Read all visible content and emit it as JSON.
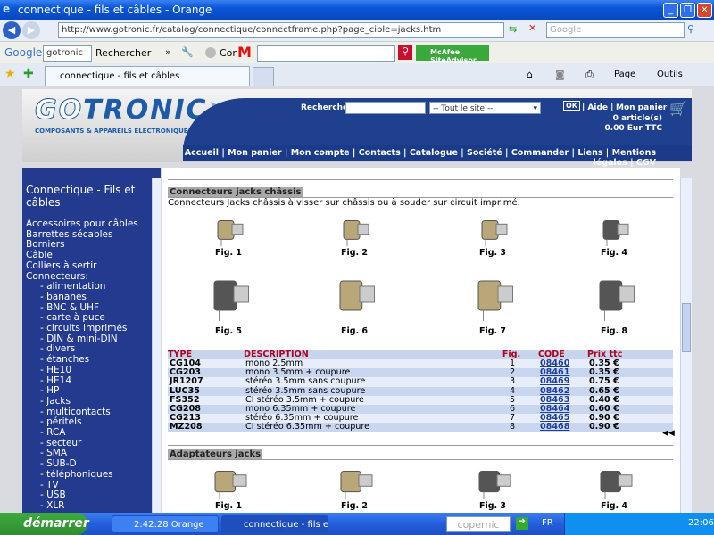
{
  "window": {
    "title": "connectique - fils et câbles - Orange"
  },
  "address": {
    "url": "http://www.gotronic.fr/catalog/connectique/connectframe.php?page_cible=jacks.htm",
    "search_placeholder": "Google"
  },
  "toolbar": {
    "google": "Google",
    "google_field": "gotronic",
    "rechercher": "Rechercher",
    "cor": "Cor",
    "mcafee": "McAfee SiteAdvisor"
  },
  "tabs": [
    {
      "label": "connectique - fils et câbles"
    }
  ],
  "cmd": {
    "page": "Page",
    "outils": "Outils"
  },
  "site": {
    "logo": "GOTRONIC",
    "tagline": "COMPOSANTS & APPAREILS ELECTRONIQUES",
    "search_label": "Recherche",
    "search_scope": "-- Tout le site --",
    "ok": "OK",
    "aide": "| Aide |",
    "panier": "Mon panier",
    "cart_count": "0 article(s)",
    "cart_total": "0.00 Eur TTC",
    "nav": [
      "Accueil",
      "Mon panier",
      "Mon compte",
      "Contacts",
      "Catalogue",
      "Société",
      "Commander",
      "Liens",
      "Mentions légales",
      "CGV"
    ]
  },
  "sidebar": {
    "title": "Connectique - Fils et câbles",
    "items": [
      "Accessoires pour câbles",
      "Barrettes sécables",
      "Borniers",
      "Câble",
      "Colliers à sertir",
      "Connecteurs:",
      "- alimentation",
      "- bananes",
      "- BNC & UHF",
      "- carte à puce",
      "- circuits imprimés",
      "- DIN & mini-DIN",
      "- divers",
      "- étanches",
      "- HE10",
      "- HE14",
      "- HP",
      "- Jacks",
      "- multicontacts",
      "- péritels",
      "- RCA",
      "- secteur",
      "- SMA",
      "- SUB-D",
      "- téléphoniques",
      "- TV",
      "- USB",
      "- XLR"
    ]
  },
  "section1": {
    "title": "Connecteurs jacks châssis",
    "desc": "Connecteurs Jacks châssis à visser sur châssis ou à souder sur circuit imprimé.",
    "figs": [
      "Fig. 1",
      "Fig. 2",
      "Fig. 3",
      "Fig. 4",
      "Fig. 5",
      "Fig. 6",
      "Fig. 7",
      "Fig. 8"
    ]
  },
  "table": {
    "headers": [
      "TYPE",
      "DESCRIPTION",
      "Fig.",
      "CODE",
      "Prix ttc"
    ],
    "rows": [
      [
        "CG104",
        "mono 2.5mm",
        "1",
        "08460",
        "0.35 €"
      ],
      [
        "CG203",
        "mono 3.5mm + coupure",
        "2",
        "08461",
        "0.35 €"
      ],
      [
        "JR1207",
        "stéréo 3.5mm sans coupure",
        "3",
        "08469",
        "0.75 €"
      ],
      [
        "LUC35",
        "stéréo 3.5mm sans coupure",
        "4",
        "08462",
        "0.65 €"
      ],
      [
        "FS352",
        "CI stéréo 3.5mm + coupure",
        "5",
        "08463",
        "0.40 €"
      ],
      [
        "CG208",
        "mono 6.35mm + coupure",
        "6",
        "08464",
        "0.60 €"
      ],
      [
        "CG213",
        "stéréo 6.35mm + coupure",
        "7",
        "08465",
        "0.90 €"
      ],
      [
        "MZ208",
        "CI stéréo 6.35mm + coupure",
        "8",
        "08468",
        "0.90 €"
      ]
    ]
  },
  "back": "◀◀",
  "section2": {
    "title": "Adaptateurs jacks",
    "figs": [
      "Fig. 1",
      "Fig. 2",
      "Fig. 3",
      "Fig. 4"
    ]
  },
  "taskbar": {
    "start": "démarrer",
    "tasks": [
      "2:42:28 Orange",
      "connectique - fils et c..."
    ],
    "search": "copernic",
    "lang": "FR",
    "clock": "22:06"
  }
}
